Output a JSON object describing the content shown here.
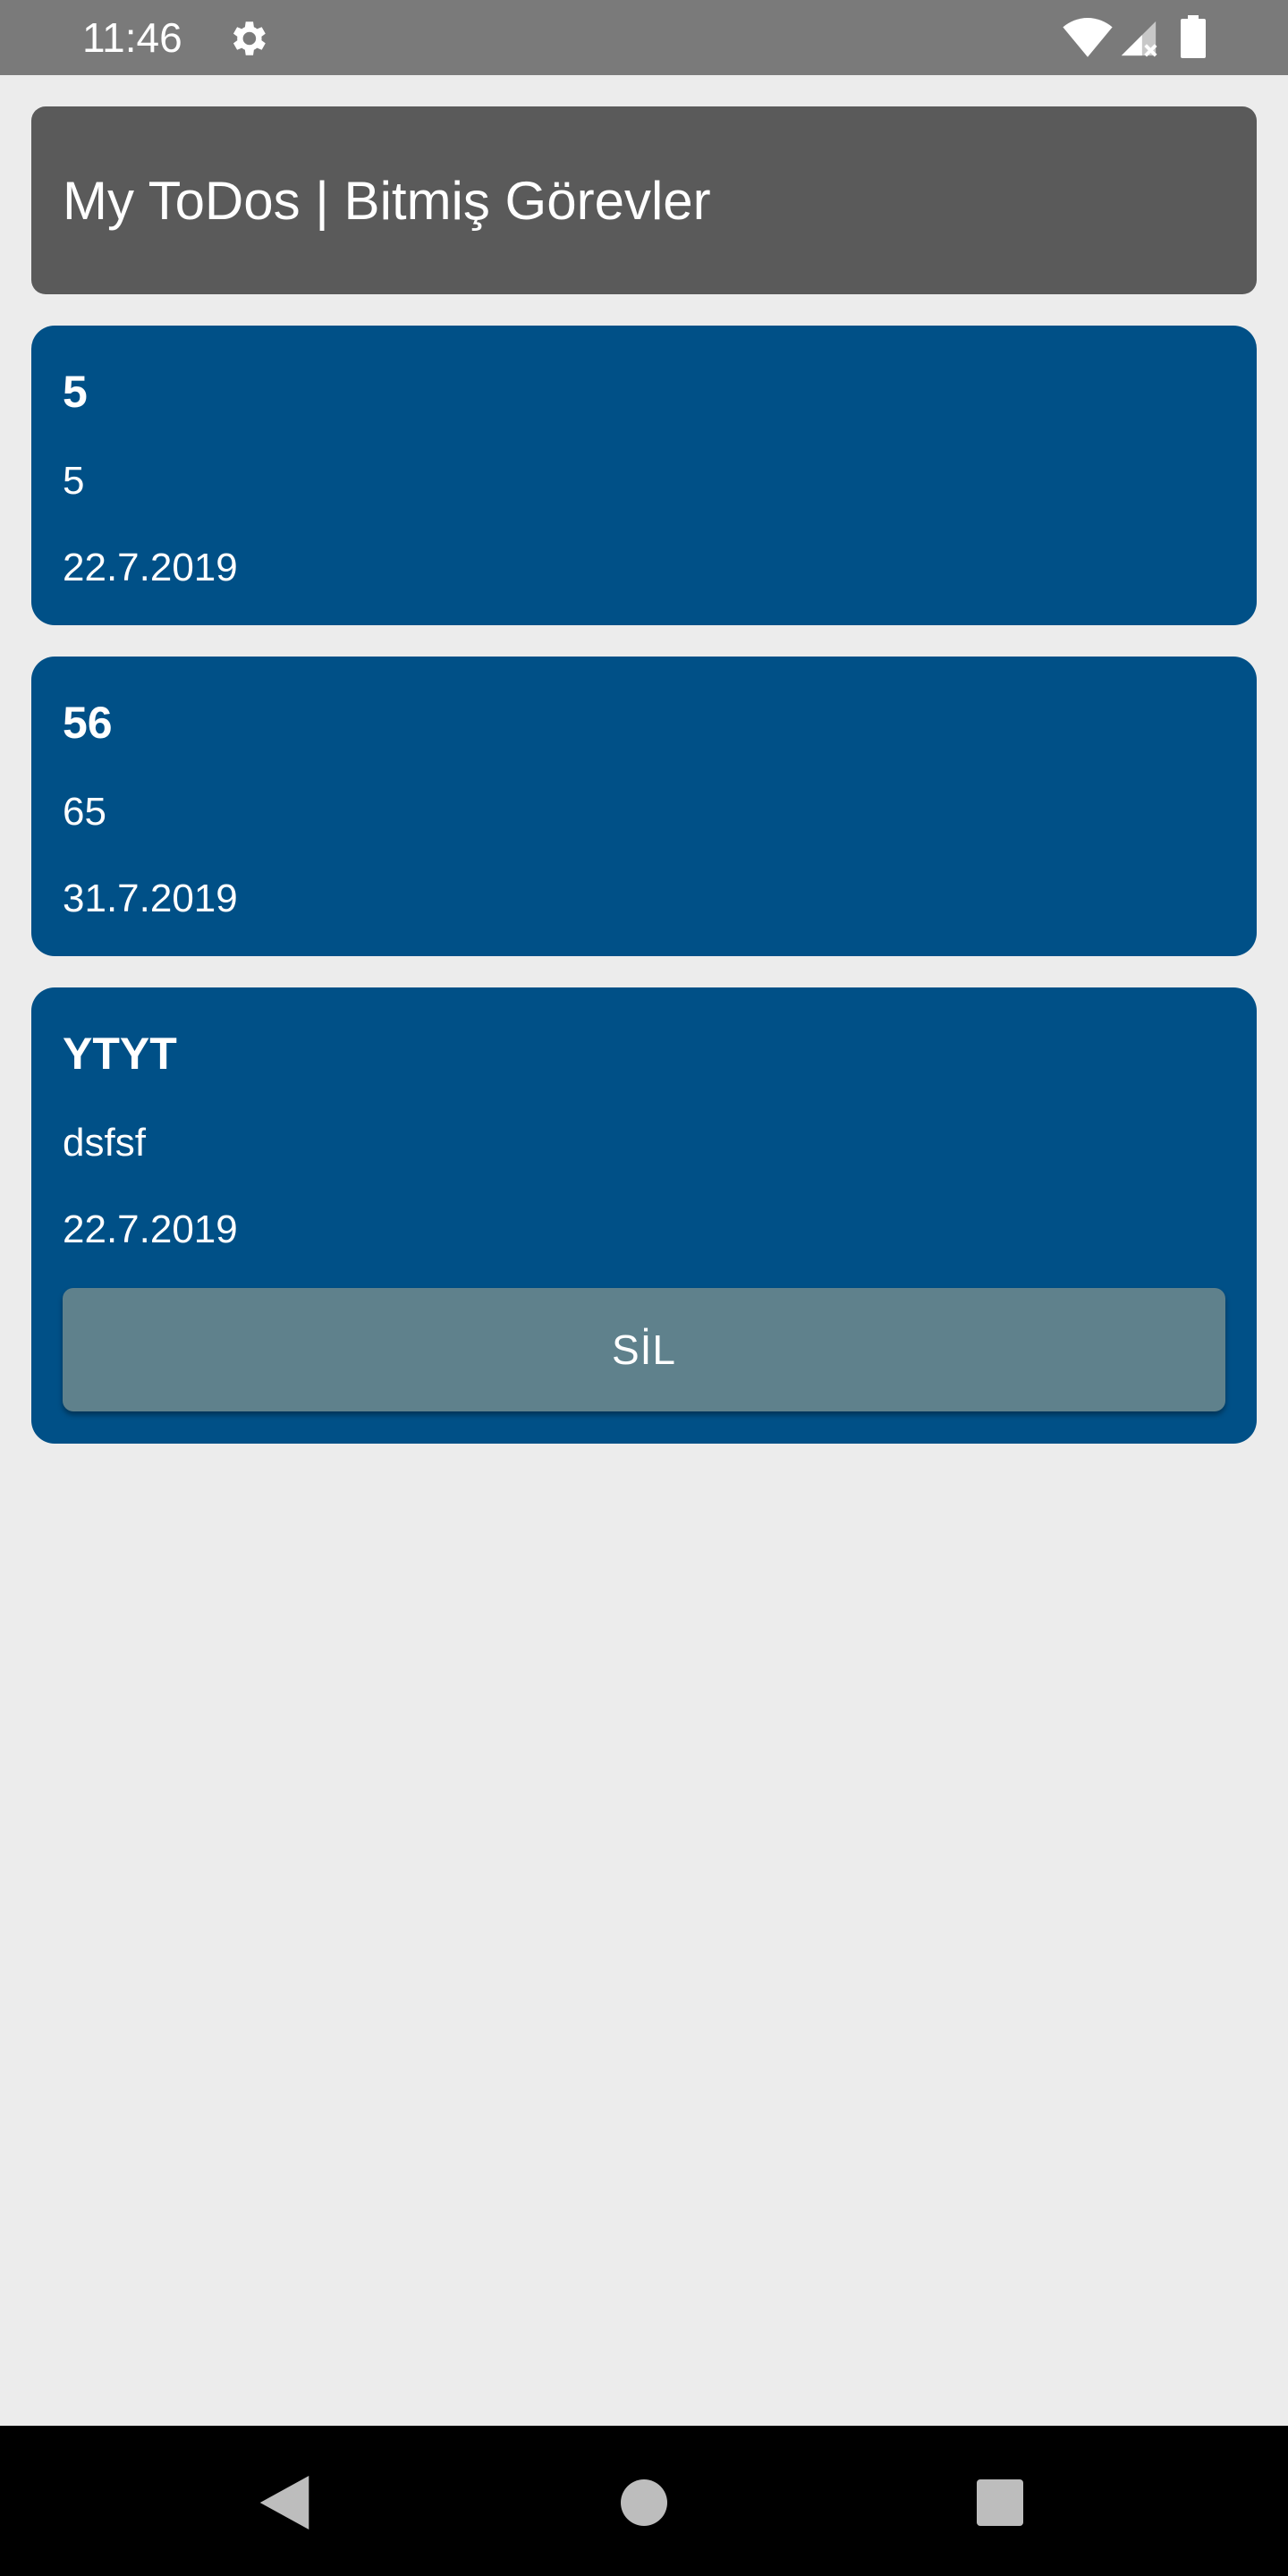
{
  "status_bar": {
    "time": "11:46",
    "icons": [
      "gear-icon",
      "wifi-icon",
      "signal-icon",
      "battery-icon"
    ]
  },
  "header": {
    "title": "My ToDos | Bitmiş Görevler"
  },
  "todos": [
    {
      "title": "5",
      "description": "5",
      "date": "22.7.2019"
    },
    {
      "title": "56",
      "description": "65",
      "date": "31.7.2019"
    },
    {
      "title": "YTYT",
      "description": "dsfsf",
      "date": "22.7.2019",
      "delete_label": "SİL"
    }
  ],
  "nav_bar": {
    "icons": [
      "back-icon",
      "home-icon",
      "recents-icon"
    ]
  },
  "colors": {
    "status_bar": "#7a7a7a",
    "background": "#ececec",
    "header": "#5a5a5a",
    "card": "#005087",
    "delete_button": "#5f818c",
    "nav_bar": "#000000"
  }
}
